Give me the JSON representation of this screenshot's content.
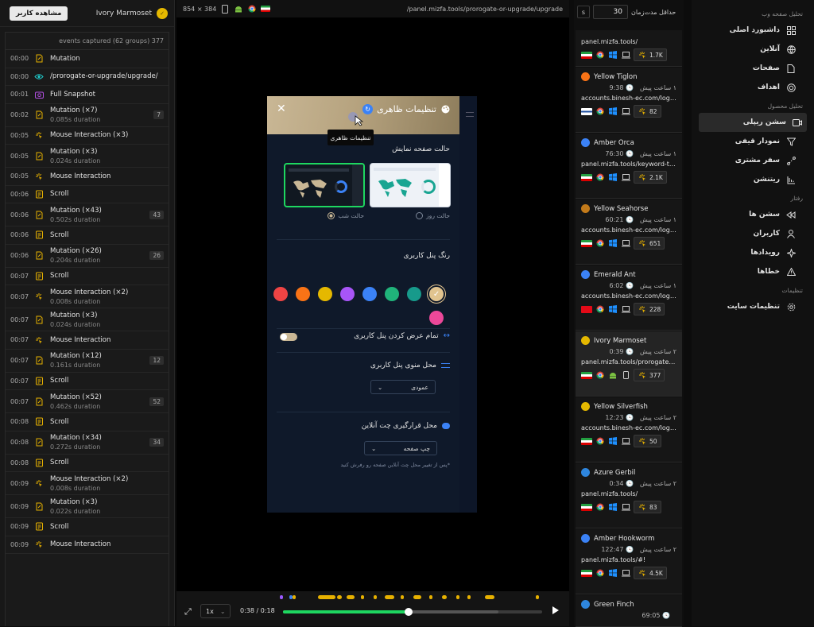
{
  "left": {
    "view_button": "مشاهده کاربر",
    "user_name": "Ivory Marmoset",
    "events_summary": "events captured (62 groups) 377",
    "events": [
      {
        "time": "00:00",
        "label": "Mutation",
        "sub": "",
        "count": "",
        "icon": "mutation"
      },
      {
        "time": "00:00",
        "label": "/prorogate-or-upgrade/upgrade/",
        "sub": "",
        "count": "",
        "icon": "eye"
      },
      {
        "time": "00:01",
        "label": "Full Snapshot",
        "sub": "",
        "count": "",
        "icon": "camera"
      },
      {
        "time": "00:02",
        "label": "Mutation (×7)",
        "sub": "0.085s duration",
        "count": "7",
        "icon": "mutation"
      },
      {
        "time": "00:05",
        "label": "Mouse Interaction (×3)",
        "sub": "",
        "count": "",
        "icon": "mouse"
      },
      {
        "time": "00:05",
        "label": "Mutation (×3)",
        "sub": "0.024s duration",
        "count": "",
        "icon": "mutation"
      },
      {
        "time": "00:05",
        "label": "Mouse Interaction",
        "sub": "",
        "count": "",
        "icon": "mouse"
      },
      {
        "time": "00:06",
        "label": "Scroll",
        "sub": "",
        "count": "",
        "icon": "scroll"
      },
      {
        "time": "00:06",
        "label": "Mutation (×43)",
        "sub": "0.502s duration",
        "count": "43",
        "icon": "mutation"
      },
      {
        "time": "00:06",
        "label": "Scroll",
        "sub": "",
        "count": "",
        "icon": "scroll"
      },
      {
        "time": "00:06",
        "label": "Mutation (×26)",
        "sub": "0.204s duration",
        "count": "26",
        "icon": "mutation"
      },
      {
        "time": "00:07",
        "label": "Scroll",
        "sub": "",
        "count": "",
        "icon": "scroll"
      },
      {
        "time": "00:07",
        "label": "Mouse Interaction (×2)",
        "sub": "0.008s duration",
        "count": "",
        "icon": "mouse"
      },
      {
        "time": "00:07",
        "label": "Mutation (×3)",
        "sub": "0.024s duration",
        "count": "",
        "icon": "mutation"
      },
      {
        "time": "00:07",
        "label": "Mouse Interaction",
        "sub": "",
        "count": "",
        "icon": "mouse"
      },
      {
        "time": "00:07",
        "label": "Mutation (×12)",
        "sub": "0.161s duration",
        "count": "12",
        "icon": "mutation"
      },
      {
        "time": "00:07",
        "label": "Scroll",
        "sub": "",
        "count": "",
        "icon": "scroll"
      },
      {
        "time": "00:07",
        "label": "Mutation (×52)",
        "sub": "0.462s duration",
        "count": "52",
        "icon": "mutation"
      },
      {
        "time": "00:08",
        "label": "Scroll",
        "sub": "",
        "count": "",
        "icon": "scroll"
      },
      {
        "time": "00:08",
        "label": "Mutation (×34)",
        "sub": "0.272s duration",
        "count": "34",
        "icon": "mutation"
      },
      {
        "time": "00:08",
        "label": "Scroll",
        "sub": "",
        "count": "",
        "icon": "scroll"
      },
      {
        "time": "00:09",
        "label": "Mouse Interaction (×2)",
        "sub": "0.008s duration",
        "count": "",
        "icon": "mouse"
      },
      {
        "time": "00:09",
        "label": "Mutation (×3)",
        "sub": "0.022s duration",
        "count": "",
        "icon": "mutation"
      },
      {
        "time": "00:09",
        "label": "Scroll",
        "sub": "",
        "count": "",
        "icon": "scroll"
      },
      {
        "time": "00:09",
        "label": "Mouse Interaction",
        "sub": "",
        "count": "",
        "icon": "mouse"
      }
    ]
  },
  "player": {
    "url": "/panel.mizfa.tools/prorogate-or-upgrade/upgrade",
    "resolution": "854 × 384",
    "speed": "1x",
    "time": "0:38 / 0:18",
    "progress": 0.485,
    "buffered": 0.83,
    "markers_colors": {
      "purple": "#9b59ff",
      "blue": "#3b82f6",
      "yellow": "#e7b100"
    }
  },
  "modal": {
    "title": "تنظیمات ظاهری",
    "tooltip": "تنظیمات ظاهری",
    "display_mode": "حالت صفحه نمایش",
    "day_mode": "حالت روز",
    "night_mode": "حالت شب",
    "panel_color": "رنگ پنل کاربری",
    "colors": [
      "#e1c48f",
      "#179a8b",
      "#20b37a",
      "#3b82f6",
      "#a855f7",
      "#e5b800",
      "#f97316",
      "#ef4444",
      "#ec4899"
    ],
    "full_width": "تمام عرض کردن پنل کاربری",
    "menu_position": "محل منوی پنل کاربری",
    "menu_value": "عمودی",
    "chat_position": "محل قرارگیری چت آنلاین",
    "chat_value": "چپ صفحه",
    "chat_note": "*پس از تغییر محل چت آنلاین صفحه رو رفرش کنید"
  },
  "sessions": {
    "min_duration_label": "حداقل مدت‌زمان",
    "min_duration": "30",
    "unit": "s",
    "items": [
      {
        "name": "",
        "time": "",
        "ago": "",
        "url": "panel.mizfa.tools/",
        "flag": "ir",
        "os": "windows",
        "device": "desktop",
        "count": "1.7K",
        "color": ""
      },
      {
        "name": "Yellow Tiglon",
        "time": "9:38",
        "ago": "۱ ساعت پیش",
        "url": "accounts.binesh-ec.com/login/",
        "flag": "fi",
        "os": "windows",
        "device": "desktop",
        "count": "82",
        "color": "#f97316"
      },
      {
        "name": "Amber Orca",
        "time": "76:30",
        "ago": "۱ ساعت پیش",
        "url": "panel.mizfa.tools/keyword-trac...",
        "flag": "ir",
        "os": "windows",
        "device": "desktop",
        "count": "2.1K",
        "color": "#3b82f6"
      },
      {
        "name": "Yellow Seahorse",
        "time": "60:21",
        "ago": "۱ ساعت پیش",
        "url": "accounts.binesh-ec.com/login/",
        "flag": "ir",
        "os": "windows",
        "device": "desktop",
        "count": "651",
        "color": "#c27a1a"
      },
      {
        "name": "Emerald Ant",
        "time": "6:02",
        "ago": "۱ ساعت پیش",
        "url": "accounts.binesh-ec.com/login/",
        "flag": "tr",
        "os": "windows",
        "device": "desktop",
        "count": "228",
        "color": "#3b82f6"
      },
      {
        "name": "Ivory Marmoset",
        "time": "0:39",
        "ago": "۲ ساعت پیش",
        "url": "panel.mizfa.tools/prorogate-or-...",
        "flag": "ir",
        "os": "android",
        "device": "mobile",
        "count": "377",
        "color": "#e5b800"
      },
      {
        "name": "Yellow Silverfish",
        "time": "12:23",
        "ago": "۲ ساعت پیش",
        "url": "accounts.binesh-ec.com/login/",
        "flag": "ir",
        "os": "windows",
        "device": "desktop",
        "count": "50",
        "color": "#e5b800"
      },
      {
        "name": "Azure Gerbil",
        "time": "0:34",
        "ago": "۲ ساعت پیش",
        "url": "panel.mizfa.tools/",
        "flag": "ir",
        "os": "windows",
        "device": "desktop",
        "count": "83",
        "color": "#2e86de"
      },
      {
        "name": "Amber Hookworm",
        "time": "122:47",
        "ago": "۲ ساعت پیش",
        "url": "panel.mizfa.tools/#!",
        "flag": "ir",
        "os": "windows",
        "device": "desktop",
        "count": "4.5K",
        "color": "#3b82f6"
      },
      {
        "name": "Green Finch",
        "time": "69:05",
        "ago": "",
        "url": "",
        "flag": "",
        "os": "",
        "device": "",
        "count": "",
        "color": "#2e86de"
      }
    ]
  },
  "nav": {
    "sections": [
      {
        "title": "تحلیل صفحه وب",
        "items": [
          {
            "label": "داشبورد اصلی",
            "icon": "grid",
            "active": false
          },
          {
            "label": "آنلاین",
            "icon": "globe",
            "active": false
          },
          {
            "label": "صفحات",
            "icon": "file",
            "active": false
          },
          {
            "label": "اهداف",
            "icon": "target",
            "active": false
          }
        ]
      },
      {
        "title": "تحلیل محصول",
        "items": [
          {
            "label": "سشن ریپلی",
            "icon": "video",
            "active": true
          },
          {
            "label": "نمودار قیفی",
            "icon": "funnel",
            "active": false
          },
          {
            "label": "سفر مشتری",
            "icon": "route",
            "active": false
          },
          {
            "label": "ریتنشن",
            "icon": "retention",
            "active": false
          }
        ]
      },
      {
        "title": "رفتار",
        "items": [
          {
            "label": "سشن ها",
            "icon": "rewind",
            "active": false
          },
          {
            "label": "کاربران",
            "icon": "user",
            "active": false
          },
          {
            "label": "رویدادها",
            "icon": "sparkle",
            "active": false
          },
          {
            "label": "خطاها",
            "icon": "alert",
            "active": false
          }
        ]
      },
      {
        "title": "تنظیمات",
        "items": [
          {
            "label": "تنظیمات سایت",
            "icon": "gear",
            "active": false
          }
        ]
      }
    ]
  }
}
